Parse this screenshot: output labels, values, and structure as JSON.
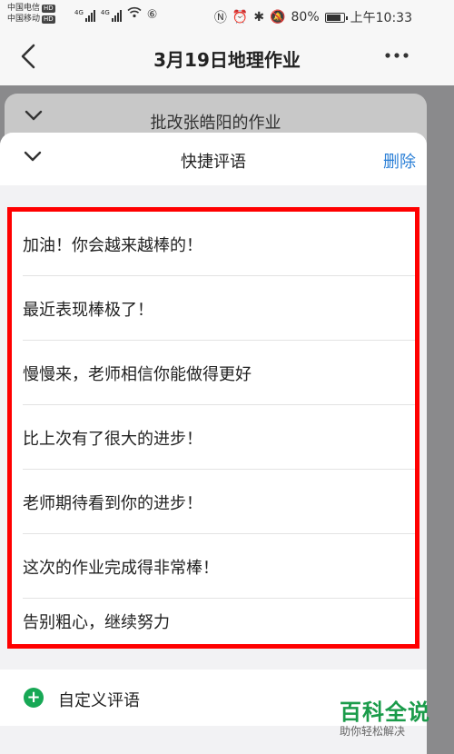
{
  "status_bar": {
    "carrier1": "中国电信",
    "carrier2": "中国移动",
    "hd": "HD",
    "net": "4G",
    "battery": "80%",
    "time": "上午10:33"
  },
  "nav": {
    "back_icon": "chevron-left-icon",
    "title": "3月19日地理作业",
    "more_icon": "more-horizontal-icon"
  },
  "behind_sheet": {
    "title": "批改张皓阳的作业"
  },
  "sheet": {
    "title": "快捷评语",
    "delete_label": "删除",
    "comments": [
      "加油！你会越来越棒的！",
      "最近表现棒极了！",
      "慢慢来，老师相信你能做得更好",
      "比上次有了很大的进步！",
      "老师期待看到你的进步！",
      "这次的作业完成得非常棒！",
      "告别粗心，继续努力"
    ],
    "custom_label": "自定义评语"
  },
  "highlight_color": "#ff0000",
  "accent_color": "#2b7fd6",
  "plus_color": "#17a855",
  "watermark": {
    "title": "百科全说",
    "subtitle": "助你轻松解决"
  }
}
